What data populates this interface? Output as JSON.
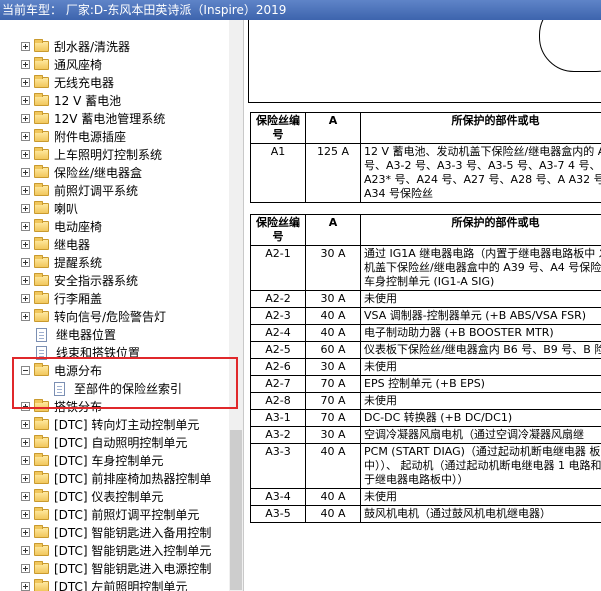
{
  "title": "当前车型：  厂家:D-东风本田英诗派（Inspire）2019",
  "tree": {
    "items": [
      {
        "label": "刮水器/清洗器",
        "type": "folder"
      },
      {
        "label": "通风座椅",
        "type": "folder"
      },
      {
        "label": "无线充电器",
        "type": "folder"
      },
      {
        "label": "12 V 蓄电池",
        "type": "folder"
      },
      {
        "label": "12V 蓄电池管理系统",
        "type": "folder"
      },
      {
        "label": "附件电源插座",
        "type": "folder"
      },
      {
        "label": "上车照明灯控制系统",
        "type": "folder"
      },
      {
        "label": "保险丝/继电器盒",
        "type": "folder"
      },
      {
        "label": "前照灯调平系统",
        "type": "folder"
      },
      {
        "label": "喇叭",
        "type": "folder"
      },
      {
        "label": "电动座椅",
        "type": "folder"
      },
      {
        "label": "继电器",
        "type": "folder"
      },
      {
        "label": "提醒系统",
        "type": "folder"
      },
      {
        "label": "安全指示器系统",
        "type": "folder"
      },
      {
        "label": "行李厢盖",
        "type": "folder"
      },
      {
        "label": "转向信号/危险警告灯",
        "type": "folder"
      },
      {
        "label": "继电器位置",
        "type": "doc"
      },
      {
        "label": "线束和搭铁位置",
        "type": "doc"
      },
      {
        "label": "电源分布",
        "type": "folder-open"
      },
      {
        "label": "至部件的保险丝索引",
        "type": "doc-child"
      },
      {
        "label": "搭铁分布",
        "type": "folder"
      },
      {
        "label": "[DTC] 转向灯主动控制单元",
        "type": "folder"
      },
      {
        "label": "[DTC] 自动照明控制单元",
        "type": "folder"
      },
      {
        "label": "[DTC] 车身控制单元",
        "type": "folder"
      },
      {
        "label": "[DTC] 前排座椅加热器控制单",
        "type": "folder"
      },
      {
        "label": "[DTC] 仪表控制单元",
        "type": "folder"
      },
      {
        "label": "[DTC] 前照灯调平控制单元",
        "type": "folder"
      },
      {
        "label": "[DTC] 智能钥匙进入备用控制",
        "type": "folder"
      },
      {
        "label": "[DTC] 智能钥匙进入控制单元",
        "type": "folder"
      },
      {
        "label": "[DTC] 智能钥匙进入电源控制",
        "type": "folder"
      },
      {
        "label": "[DTC] 左前照明控制单元",
        "type": "folder"
      }
    ]
  },
  "table1": {
    "headers": [
      "保险丝编号",
      "A",
      "所保护的部件或电"
    ],
    "rows": [
      {
        "num": "A1",
        "amp": "125 A",
        "desc": "12 V 蓄电池、发动机盖下保险丝/继电器盒内的 A3-1 号、A3-2 号、A3-3 号、A3-5 号、A3-7 4 号、A23* 号、A24 号、A27 号、A28 号、A A32 号和 A34 号保险丝"
      }
    ]
  },
  "table2": {
    "headers": [
      "保险丝编号",
      "A",
      "所保护的部件或电"
    ],
    "rows": [
      {
        "num": "A2-1",
        "amp": "30 A",
        "desc": "通过 IG1A 继电器电路（内置于继电器电路板中 发动机盖下保险丝/继电器盒中的 A39 号、A4 号保险丝。 车身控制单元 (IG1-A SIG)"
      },
      {
        "num": "A2-2",
        "amp": "30 A",
        "desc": "未使用"
      },
      {
        "num": "A2-3",
        "amp": "40 A",
        "desc": "VSA 调制器-控制器单元 (+B ABS/VSA FSR)"
      },
      {
        "num": "A2-4",
        "amp": "40 A",
        "desc": "电子制动助力器 (+B BOOSTER MTR)"
      },
      {
        "num": "A2-5",
        "amp": "60 A",
        "desc": "仪表板下保险丝/继电器盒内 B6 号、B9 号、B 险丝"
      },
      {
        "num": "A2-6",
        "amp": "30 A",
        "desc": "未使用"
      },
      {
        "num": "A2-7",
        "amp": "70 A",
        "desc": "EPS 控制单元 (+B EPS)"
      },
      {
        "num": "A2-8",
        "amp": "70 A",
        "desc": "未使用"
      },
      {
        "num": "A3-1",
        "amp": "70 A",
        "desc": "DC-DC 转换器 (+B DC/DC1)"
      },
      {
        "num": "A3-2",
        "amp": "30 A",
        "desc": "空调冷凝器风扇电机（通过空调冷凝器风扇继"
      },
      {
        "num": "A3-3",
        "amp": "40 A",
        "desc": "PCM (START DIAG)（通过起动机断电继电器 板中））、 起动机（通过起动机断电继电器 1 电路和起动 于继电器电路板中））"
      },
      {
        "num": "A3-4",
        "amp": "40 A",
        "desc": "未使用"
      },
      {
        "num": "A3-5",
        "amp": "40 A",
        "desc": "鼓风机电机（通过鼓风机电机继电器）"
      }
    ]
  },
  "colors": {
    "titlebar": "#4a71ba",
    "highlight": "#e0282b",
    "folder": "#f1c75c"
  }
}
